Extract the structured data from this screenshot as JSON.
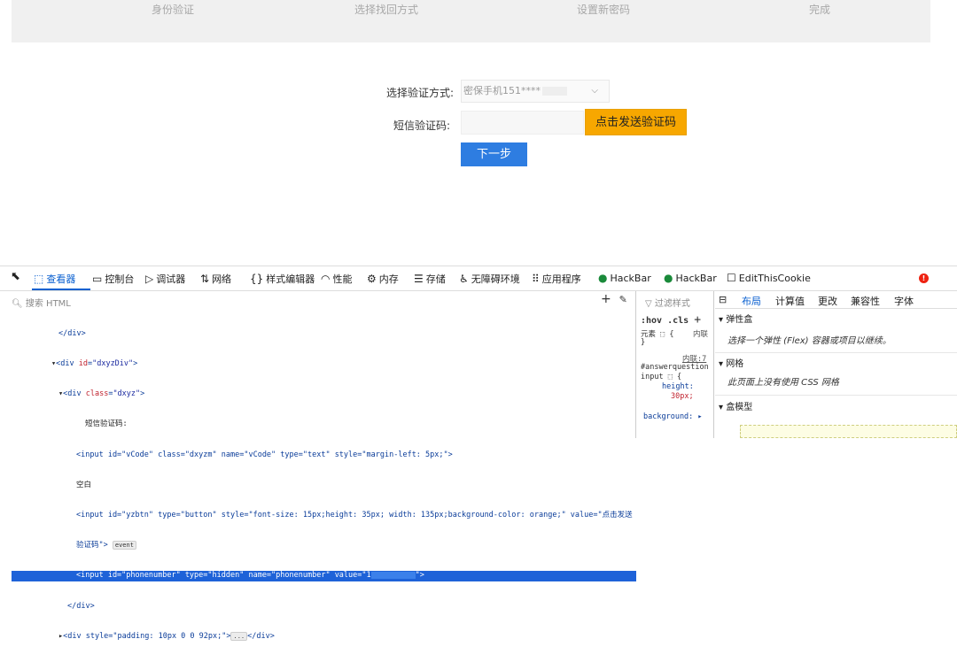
{
  "steps": [
    "身份验证",
    "选择找回方式",
    "设置新密码",
    "完成"
  ],
  "form": {
    "method_label": "选择验证方式:",
    "method_value": "密保手机151****",
    "sms_label": "短信验证码:",
    "send_button": "点击发送验证码",
    "next_button": "下一步"
  },
  "devtools": {
    "tabs": [
      {
        "icon": "⬚",
        "label": "查看器"
      },
      {
        "icon": "▭",
        "label": "控制台"
      },
      {
        "icon": "▷",
        "label": "调试器"
      },
      {
        "icon": "⇅",
        "label": "网络"
      },
      {
        "icon": "{}",
        "label": "样式编辑器"
      },
      {
        "icon": "◠",
        "label": "性能"
      },
      {
        "icon": "⚙",
        "label": "内存"
      },
      {
        "icon": "☰",
        "label": "存储"
      },
      {
        "icon": "♿",
        "label": "无障碍环境"
      },
      {
        "icon": "⠿",
        "label": "应用程序"
      },
      {
        "icon": "●",
        "label": "HackBar"
      },
      {
        "icon": "●",
        "label": "HackBar"
      },
      {
        "icon": "☐",
        "label": "EditThisCookie"
      }
    ],
    "search_placeholder": "搜索 HTML",
    "code": {
      "l1": "</div>",
      "l2a": "<div ",
      "l2attr": "id",
      "l2val": "\"dxyzDiv\"",
      "l2b": ">",
      "l3a": "<div ",
      "l3attr": "class",
      "l3val": "\"dxyz\"",
      "l3b": ">",
      "l4": "短信验证码:",
      "l5": "<input id=\"vCode\" class=\"dxyzm\" name=\"vCode\" type=\"text\" style=\"margin-left: 5px;\">",
      "l6": "空白",
      "l7": "<input id=\"yzbtn\" type=\"button\" style=\"font-size: 15px;height: 35px; width: 135px;background-color: orange;\" value=\"点击发送",
      "l8": "验证码\">",
      "l8badge": "event",
      "l9a": "<input id=\"phonenumber\" type=\"hidden\" name=\"phonenumber\" value=\"1",
      "l9b": "\">",
      "l10": "</div>",
      "l11": "<div style=\"padding: 10px 0 0 92px;\">",
      "l11badge": "...",
      "l11end": "</div>"
    },
    "rules": {
      "filter": "过滤样式",
      "hov": ":hov .cls",
      "elem": "元素 ⬚ {",
      "inline": "内联",
      "close": "}",
      "source": "内联:7",
      "selector": "#answerquestion",
      "selector2": "input ⬚ {",
      "prop1": "height:",
      "val1": "30px;",
      "prop2": "background: ▸"
    },
    "layout_tabs": [
      "布局",
      "计算值",
      "更改",
      "兼容性",
      "字体"
    ],
    "flex_header": "弹性盒",
    "flex_text": "选择一个弹性 (Flex) 容器或项目以继续。",
    "grid_header": "网格",
    "grid_text": "此页面上没有使用 CSS 网格",
    "boxmodel_header": "盒模型"
  }
}
